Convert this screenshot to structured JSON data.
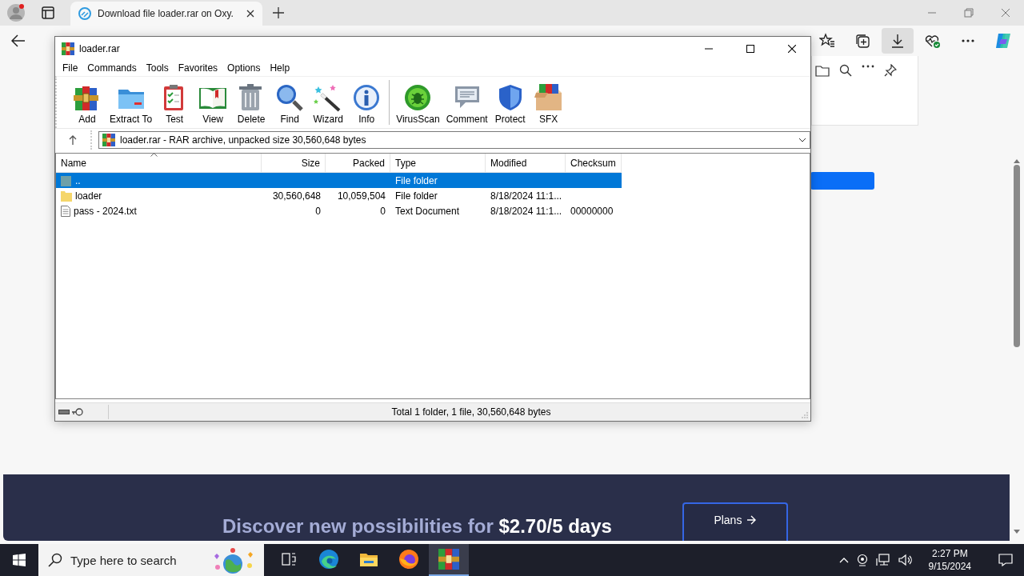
{
  "browser": {
    "tabs": [
      {
        "title": "Download file loader.rar on Oxy.",
        "selected": true
      }
    ],
    "toolbar": [
      {
        "kind": "favorites",
        "selected": false
      },
      {
        "kind": "collections",
        "selected": false
      },
      {
        "kind": "downloads",
        "selected": true
      },
      {
        "kind": "health",
        "selected": false
      },
      {
        "kind": "more",
        "selected": false
      },
      {
        "kind": "copilot",
        "selected": false
      }
    ],
    "banner": {
      "text": "Discover new possibilities for **$2.70/5 days**",
      "button": "Plans"
    }
  },
  "winrar": {
    "title": "loader.rar",
    "menu": [
      "File",
      "Commands",
      "Tools",
      "Favorites",
      "Options",
      "Help"
    ],
    "tools": [
      {
        "label": "Add",
        "kind": "add"
      },
      {
        "label": "Extract To",
        "kind": "extract"
      },
      {
        "label": "Test",
        "kind": "test"
      },
      {
        "label": "View",
        "kind": "view"
      },
      {
        "label": "Delete",
        "kind": "delete"
      },
      {
        "label": "Find",
        "kind": "find"
      },
      {
        "label": "Wizard",
        "kind": "wizard"
      },
      {
        "label": "Info",
        "kind": "info"
      },
      {
        "label": "VirusScan",
        "kind": "virus"
      },
      {
        "label": "Comment",
        "kind": "comment"
      },
      {
        "label": "Protect",
        "kind": "protect"
      },
      {
        "label": "SFX",
        "kind": "sfx"
      }
    ],
    "address": "loader.rar - RAR archive, unpacked size 30,560,648 bytes",
    "columns": [
      "Name",
      "Size",
      "Packed",
      "Type",
      "Modified",
      "Checksum"
    ],
    "rows": [
      {
        "kind": "up",
        "selected": true,
        "cells": [
          "..",
          "",
          "",
          "File folder",
          "",
          ""
        ]
      },
      {
        "kind": "folder",
        "selected": false,
        "cells": [
          "loader",
          "30,560,648",
          "10,059,504",
          "File folder",
          "8/18/2024 11:1...",
          ""
        ]
      },
      {
        "kind": "file",
        "selected": false,
        "cells": [
          "pass - 2024.txt",
          "0",
          "0",
          "Text Document",
          "8/18/2024 11:1...",
          "00000000"
        ]
      }
    ],
    "status": "Total 1 folder, 1 file, 30,560,648 bytes"
  },
  "taskbar": {
    "search": {
      "placeholder": "Type here to search"
    },
    "apps": [
      {
        "kind": "taskview",
        "selected": false
      },
      {
        "kind": "edge",
        "selected": false
      },
      {
        "kind": "explorer",
        "selected": false
      },
      {
        "kind": "firefox",
        "selected": false
      },
      {
        "kind": "winrar",
        "selected": true
      }
    ],
    "time": "2:27 PM",
    "date": "9/15/2024"
  }
}
